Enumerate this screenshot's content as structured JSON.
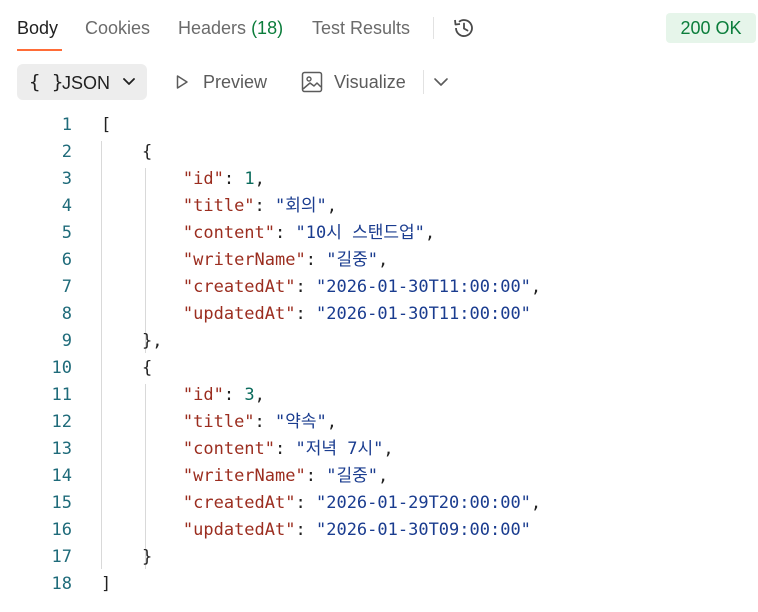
{
  "tabs": {
    "body": "Body",
    "cookies": "Cookies",
    "headers_label": "Headers",
    "headers_count": "(18)",
    "test_results": "Test Results"
  },
  "status": {
    "text": "200 OK",
    "color": "#0b7d3b"
  },
  "toolbar": {
    "format_icon": "{ }",
    "format_label": "JSON",
    "preview_label": "Preview",
    "visualize_label": "Visualize"
  },
  "icons": [
    "history-icon",
    "chevron-down-icon",
    "play-icon",
    "image-icon"
  ],
  "code_lines": [
    {
      "n": "1",
      "t": "["
    },
    {
      "n": "2",
      "t": "    {"
    },
    {
      "n": "3",
      "t": "        \"id\": 1,"
    },
    {
      "n": "4",
      "t": "        \"title\": \"회의\","
    },
    {
      "n": "5",
      "t": "        \"content\": \"10시 스탠드업\","
    },
    {
      "n": "6",
      "t": "        \"writerName\": \"길중\","
    },
    {
      "n": "7",
      "t": "        \"createdAt\": \"2026-01-30T11:00:00\","
    },
    {
      "n": "8",
      "t": "        \"updatedAt\": \"2026-01-30T11:00:00\""
    },
    {
      "n": "9",
      "t": "    },"
    },
    {
      "n": "10",
      "t": "    {"
    },
    {
      "n": "11",
      "t": "        \"id\": 3,"
    },
    {
      "n": "12",
      "t": "        \"title\": \"약속\","
    },
    {
      "n": "13",
      "t": "        \"content\": \"저녁 7시\","
    },
    {
      "n": "14",
      "t": "        \"writerName\": \"길중\","
    },
    {
      "n": "15",
      "t": "        \"createdAt\": \"2026-01-29T20:00:00\","
    },
    {
      "n": "16",
      "t": "        \"updatedAt\": \"2026-01-30T09:00:00\""
    },
    {
      "n": "17",
      "t": "    }"
    },
    {
      "n": "18",
      "t": "]"
    }
  ]
}
